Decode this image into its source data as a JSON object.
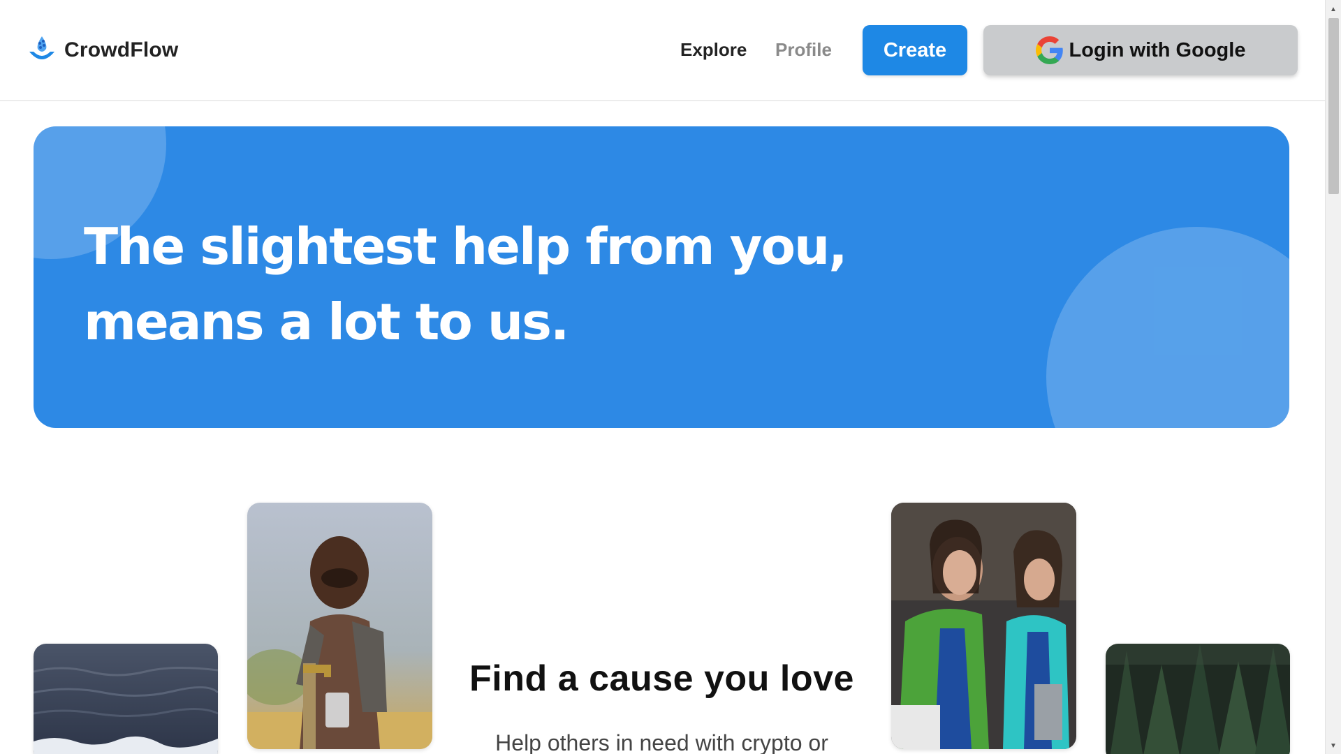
{
  "brand": {
    "name": "CrowdFlow",
    "logo_icon": "water-drop-hand-icon"
  },
  "nav": {
    "explore": "Explore",
    "profile": "Profile"
  },
  "actions": {
    "create_label": "Create",
    "login_label": "Login with Google",
    "login_icon": "google-icon"
  },
  "colors": {
    "primary": "#1e88e5",
    "hero_bg": "#2d89e5",
    "login_bg": "#c9cbcd"
  },
  "hero": {
    "title_line1": "The slightest help from you,",
    "title_line2": "means a lot to us."
  },
  "section": {
    "title": "Find a cause you love",
    "subtitle": "Help others in need with crypto or"
  },
  "images": [
    "ocean-waves-image",
    "boy-drinking-water-image",
    "volunteers-image",
    "pine-forest-image"
  ]
}
